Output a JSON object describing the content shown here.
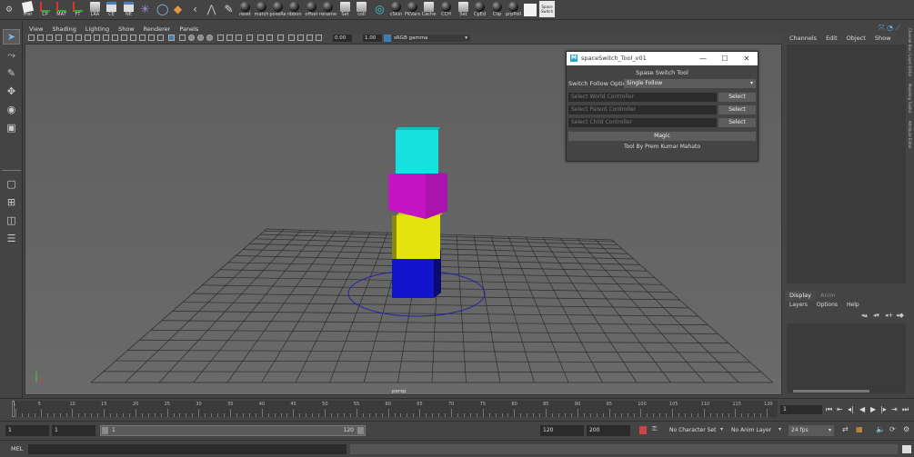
{
  "shelf": {
    "items": [
      {
        "label": "Hist",
        "icon": "history-icon"
      },
      {
        "label": "CP",
        "icon": "axis-icon"
      },
      {
        "label": "MAT",
        "icon": "axis-icon"
      },
      {
        "label": "FT",
        "icon": "axis-icon"
      },
      {
        "label": "LRA",
        "icon": "doc-icon"
      },
      {
        "label": "CE",
        "icon": "window-icon"
      },
      {
        "label": "NE",
        "icon": "window-icon"
      },
      {
        "label": "",
        "icon": "star-icon"
      },
      {
        "label": "",
        "icon": "circle-icon"
      },
      {
        "label": "",
        "icon": "diamond-icon"
      },
      {
        "label": "",
        "icon": "chevron-icon"
      },
      {
        "label": "",
        "icon": "joint-icon"
      },
      {
        "label": "",
        "icon": "paint-icon"
      },
      {
        "label": "reset",
        "icon": "ball-icon"
      },
      {
        "label": "match",
        "icon": "ball-icon"
      },
      {
        "label": "poseRe",
        "icon": "ball-icon"
      },
      {
        "label": "ribbon",
        "icon": "ball-icon"
      },
      {
        "label": "offset",
        "icon": "ball-icon"
      },
      {
        "label": "rename",
        "icon": "ball-icon"
      },
      {
        "label": "Set",
        "icon": "doc-icon"
      },
      {
        "label": "coll",
        "icon": "doc-icon"
      },
      {
        "label": "",
        "icon": "target-icon"
      },
      {
        "label": "cSkin",
        "icon": "ball-icon"
      },
      {
        "label": "FKVars",
        "icon": "ball-icon"
      },
      {
        "label": "Cache",
        "icon": "image-icon"
      },
      {
        "label": "CCH",
        "icon": "ball-icon"
      },
      {
        "label": "Set",
        "icon": "doc-icon"
      },
      {
        "label": "CpEd",
        "icon": "ball-icon"
      },
      {
        "label": "Clip",
        "icon": "ball-icon"
      },
      {
        "label": "prpPoll",
        "icon": "ball-icon"
      },
      {
        "label": "",
        "icon": "blank-icon"
      },
      {
        "label": "Space Switch",
        "icon": "space-switch-icon"
      }
    ]
  },
  "panel_menu": [
    "View",
    "Shading",
    "Lighting",
    "Show",
    "Renderer",
    "Panels"
  ],
  "panel_toolbar": {
    "exposure": "0.00",
    "gamma": "1.00",
    "color_space": "sRGB gamma"
  },
  "viewport": {
    "camera": "persp"
  },
  "channel_box": {
    "menu": [
      "Channels",
      "Edit",
      "Object",
      "Show"
    ]
  },
  "layer_editor": {
    "tabs": [
      "Display",
      "Anim"
    ],
    "menu": [
      "Layers",
      "Options",
      "Help"
    ]
  },
  "right_strip": {
    "labels": [
      "Channel Box / Layer Editor",
      "Modeling Toolkit",
      "Attribute Editor"
    ]
  },
  "time_slider": {
    "ticks": [
      "1",
      "5",
      "10",
      "15",
      "20",
      "25",
      "30",
      "35",
      "40",
      "45",
      "50",
      "55",
      "60",
      "65",
      "70",
      "75",
      "80",
      "85",
      "90",
      "95",
      "100",
      "105",
      "110",
      "115",
      "120"
    ],
    "current_frame": "1"
  },
  "range_slider": {
    "start": "1",
    "playback_start": "1",
    "bar_start": "1",
    "bar_end": "120",
    "playback_end": "120",
    "end": "200",
    "character_set": "No Character Set",
    "anim_layer": "No Anim Layer",
    "fps": "24 fps"
  },
  "command_line": {
    "label": "MEL"
  },
  "dialog": {
    "title": "spaceSwitch_Tool_v01",
    "icon_letter": "M",
    "header": "Spase Switch Tool",
    "switch_label": "Switch Follow Option",
    "switch_value": "Single Follow",
    "world_placeholder": "Select World Controller",
    "parent_placeholder": "Select Parent Controller",
    "child_placeholder": "Select Child Controller",
    "select_label": "Select",
    "magic_label": "Magic",
    "credit": "Tool By Prem Kumar Mahato"
  },
  "colors": {
    "cube_top": "#16e0e0",
    "cube_second": "#c414c4",
    "cube_third": "#e3e30f",
    "cube_bottom": "#1414cc",
    "maya_accent": "#2aa8c8"
  }
}
